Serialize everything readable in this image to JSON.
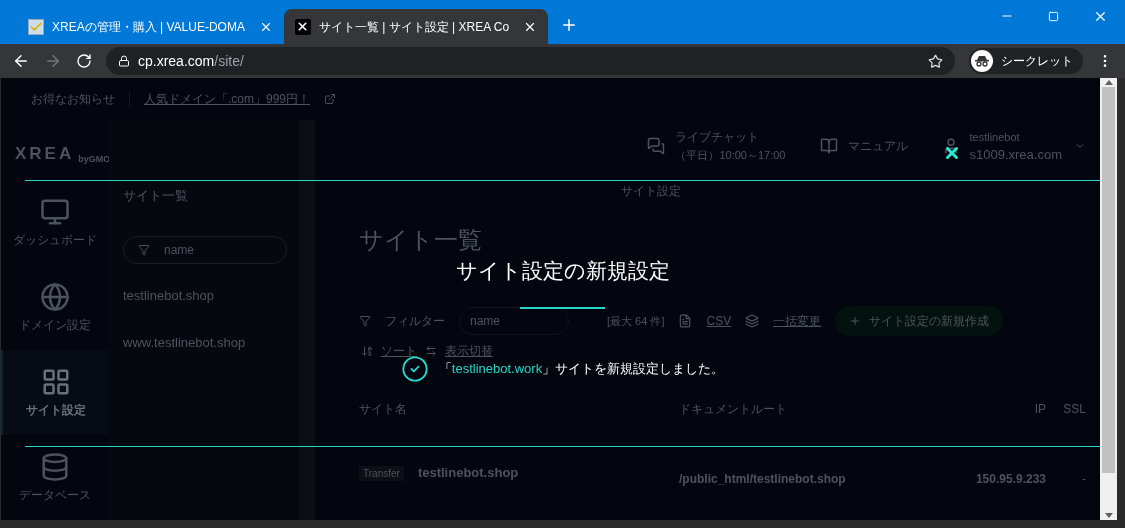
{
  "browser": {
    "tabs": [
      {
        "title": "XREAの管理・購入 | VALUE-DOMA",
        "kind": "check",
        "selected": false
      },
      {
        "title": "サイト一覧 | サイト設定 | XREA Co",
        "kind": "xrea",
        "selected": true
      }
    ],
    "address": {
      "host": "cp.xrea.com",
      "path": "/site/"
    },
    "forward_disabled": true,
    "profile_label": "シークレット"
  },
  "page": {
    "notice": {
      "label": "お得なお知らせ",
      "link": "人気ドメイン「.com」999円！"
    },
    "logo": {
      "name": "XREA",
      "by": "byGMO"
    },
    "nav": [
      {
        "label": "ダッシュボード",
        "kind": "monitor",
        "selected": false
      },
      {
        "label": "ドメイン設定",
        "kind": "globe",
        "selected": false
      },
      {
        "label": "サイト設定",
        "kind": "grid",
        "selected": true
      },
      {
        "label": "データベース",
        "kind": "database",
        "selected": false
      }
    ],
    "site_list": {
      "title": "サイト一覧",
      "filter_placeholder": "name",
      "items": [
        "testlinebot.shop",
        "www.testlinebot.shop"
      ]
    },
    "header": {
      "chat_title": "ライブチャット",
      "chat_hours": "（平日）10:00～17:00",
      "manual": "マニュアル",
      "user": "testlinebot",
      "server": "s1009.xrea.com"
    },
    "breadcrumb": "サイト設定",
    "heading": "サイト一覧",
    "toolbar": {
      "filter_label": "フィルター",
      "filter_placeholder": "name",
      "count": "[最大 64 件]",
      "csv": "CSV",
      "bulk": "一括変更",
      "create": "サイト設定の新規作成"
    },
    "sort": "ソート",
    "view_toggle": "表示切替",
    "table": {
      "columns": [
        "サイト名",
        "ドキュメントルート",
        "IP",
        "SSL"
      ],
      "rows": [
        {
          "badge": "Transfer",
          "name": "testlinebot.shop",
          "docroot": "/public_html/testlinebot.shop",
          "ip": "150.95.9.233",
          "ssl": "-"
        }
      ]
    }
  },
  "modal": {
    "title": "サイト設定の新規設定",
    "message": {
      "before": "「",
      "highlight": "testlinebot.work",
      "after": "」サイトを新規設定しました。"
    }
  }
}
